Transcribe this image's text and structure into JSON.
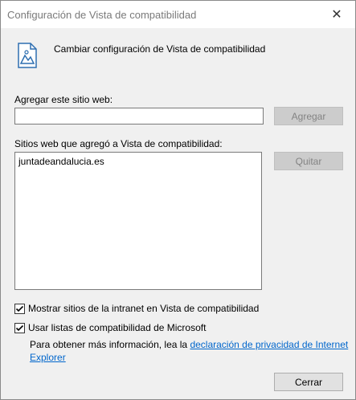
{
  "window": {
    "title": "Configuración de Vista de compatibilidad",
    "close_glyph": "✕"
  },
  "header": {
    "icon": "document-map-icon",
    "text": "Cambiar configuración de Vista de compatibilidad"
  },
  "add_site": {
    "label": "Agregar este sitio web:",
    "value": "",
    "button_label": "Agregar"
  },
  "sites": {
    "label": "Sitios web que agregó a Vista de compatibilidad:",
    "items": [
      "juntadeandalucia.es"
    ],
    "remove_label": "Quitar"
  },
  "options": {
    "intranet": {
      "label": "Mostrar sitios de la intranet en Vista de compatibilidad",
      "checked": true
    },
    "microsoft_lists": {
      "label": "Usar listas de compatibilidad de Microsoft",
      "checked": true
    }
  },
  "info": {
    "prefix": "Para obtener más información, lea la ",
    "link_line1": "declaración de privacidad de Internet",
    "link_line2": "Explorer"
  },
  "footer": {
    "close_label": "Cerrar"
  },
  "colors": {
    "link": "#0066cc",
    "disabled_button": "#cccccc"
  }
}
